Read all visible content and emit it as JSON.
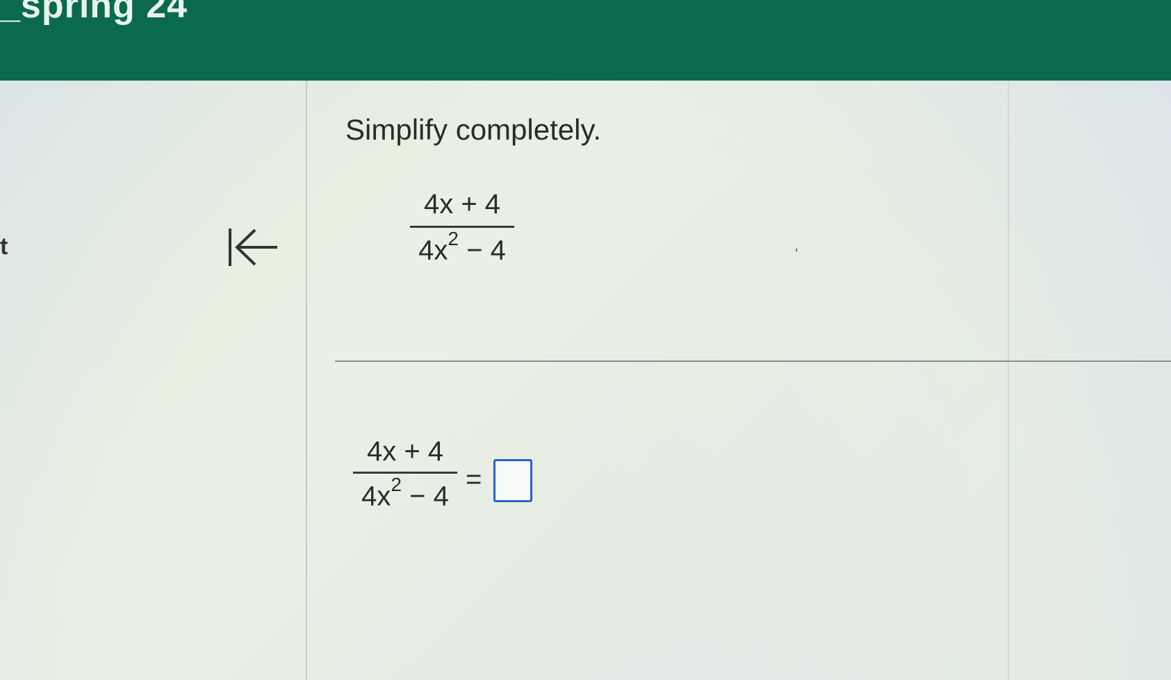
{
  "header": {
    "course_title": "_spring 24",
    "background_color": "#0b6a4e"
  },
  "left_panel": {
    "edge_text": "t",
    "collapse_icon": "collapse-left-arrow-icon"
  },
  "question": {
    "prompt": "Simplify completely.",
    "expression": {
      "numerator": "4x + 4",
      "denominator_base": "4x",
      "denominator_exponent": "2",
      "denominator_rest": " − 4"
    }
  },
  "answer": {
    "numerator": "4x + 4",
    "denominator_base": "4x",
    "denominator_exponent": "2",
    "denominator_rest": " − 4",
    "equals": "=",
    "input_value": "",
    "input_border_color": "#2a63c7"
  }
}
